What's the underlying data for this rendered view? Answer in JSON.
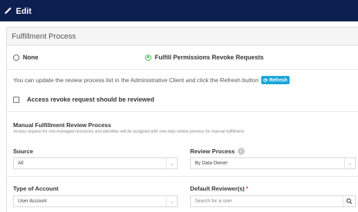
{
  "header": {
    "title": "Edit",
    "icon": "pencil-icon"
  },
  "panel": {
    "title": "Fulfillment Process"
  },
  "process_options": [
    {
      "label": "None",
      "selected": false
    },
    {
      "label": "Fulfill Permissions Revoke Requests",
      "selected": true
    }
  ],
  "info": {
    "text": "You can update the review process list in the Administrative Client and click the Refresh button",
    "refresh_label": "Refresh"
  },
  "review_checkbox": {
    "label": "Access revoke request should be reviewed",
    "checked": false
  },
  "manual_section": {
    "title": "Manual Fulfillment Review Process",
    "subtitle": "Access request for non-managed resources and identities will be assigned with one-step review process for manual fulfillment."
  },
  "fields": {
    "source": {
      "label": "Source",
      "value": "All"
    },
    "review_process": {
      "label": "Review Process",
      "value": "By Data Owner"
    },
    "type_of_account": {
      "label": "Type of Account",
      "value": "User Account"
    },
    "default_reviewer": {
      "label": "Default Reviewer(s)",
      "required_mark": "*",
      "placeholder": "Search for a user"
    }
  },
  "colors": {
    "header_bg": "#0d1f4e",
    "accent_green": "#3bb54a",
    "refresh_blue": "#1aa5d8",
    "required_red": "#e74c3c"
  }
}
